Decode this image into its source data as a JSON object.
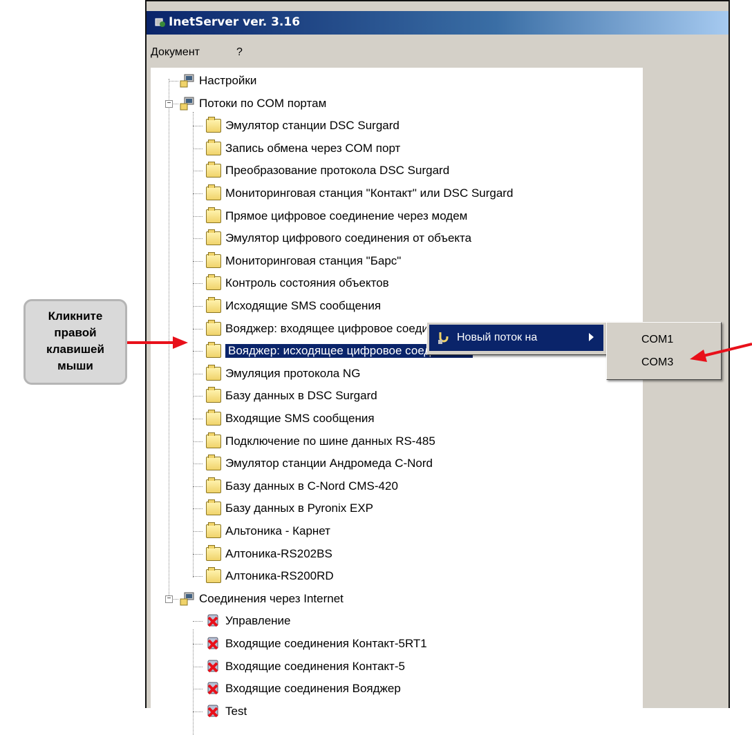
{
  "window": {
    "title": "InetServer ver. 3.16"
  },
  "menu": [
    {
      "label": "Документ"
    },
    {
      "label": "?"
    }
  ],
  "tree": {
    "settings": "Настройки",
    "com_group": "Потоки по COM портам",
    "com_items": [
      "Эмулятор станции DSC Surgard",
      "Запись обмена через COM порт",
      "Преобразование протокола DSC Surgard",
      "Мониторинговая станция \"Контакт\" или DSC Surgard",
      "Прямое цифровое соединение через модем",
      "Эмулятор цифрового соединения от объекта",
      "Мониторинговая станция \"Барс\"",
      "Контроль состояния объектов",
      "Исходящие SMS сообщения",
      "Вояджер: входящее цифровое соединение",
      "Вояджер: исходящее цифровое соединение",
      "Эмуляция протокола NG",
      "Базу данных в DSC Surgard",
      "Входящие SMS сообщения",
      "Подключение по шине данных RS-485",
      "Эмулятор станции Андромеда C-Nord",
      "Базу данных в C-Nord CMS-420",
      "Базу данных в Pyronix EXP",
      "Альтоника - Карнет",
      "Алтоника-RS202BS",
      "Алтоника-RS200RD"
    ],
    "internet_group": "Соединения через Internet",
    "internet_items": [
      "Управление",
      "Входящие соединения Контакт-5RT1",
      "Входящие соединения Контакт-5",
      "Входящие соединения Вояджер",
      "Test"
    ],
    "selected_index": 10
  },
  "context_menu": {
    "item": "Новый поток на"
  },
  "submenu": [
    "COM1",
    "COM3"
  ],
  "callout": {
    "lines": [
      "Кликните",
      "правой",
      "клавишей",
      "мыши"
    ]
  },
  "colors": {
    "highlight": "#0a246a",
    "arrow": "#e8101a",
    "callout_bg": "#d9d9d9"
  }
}
